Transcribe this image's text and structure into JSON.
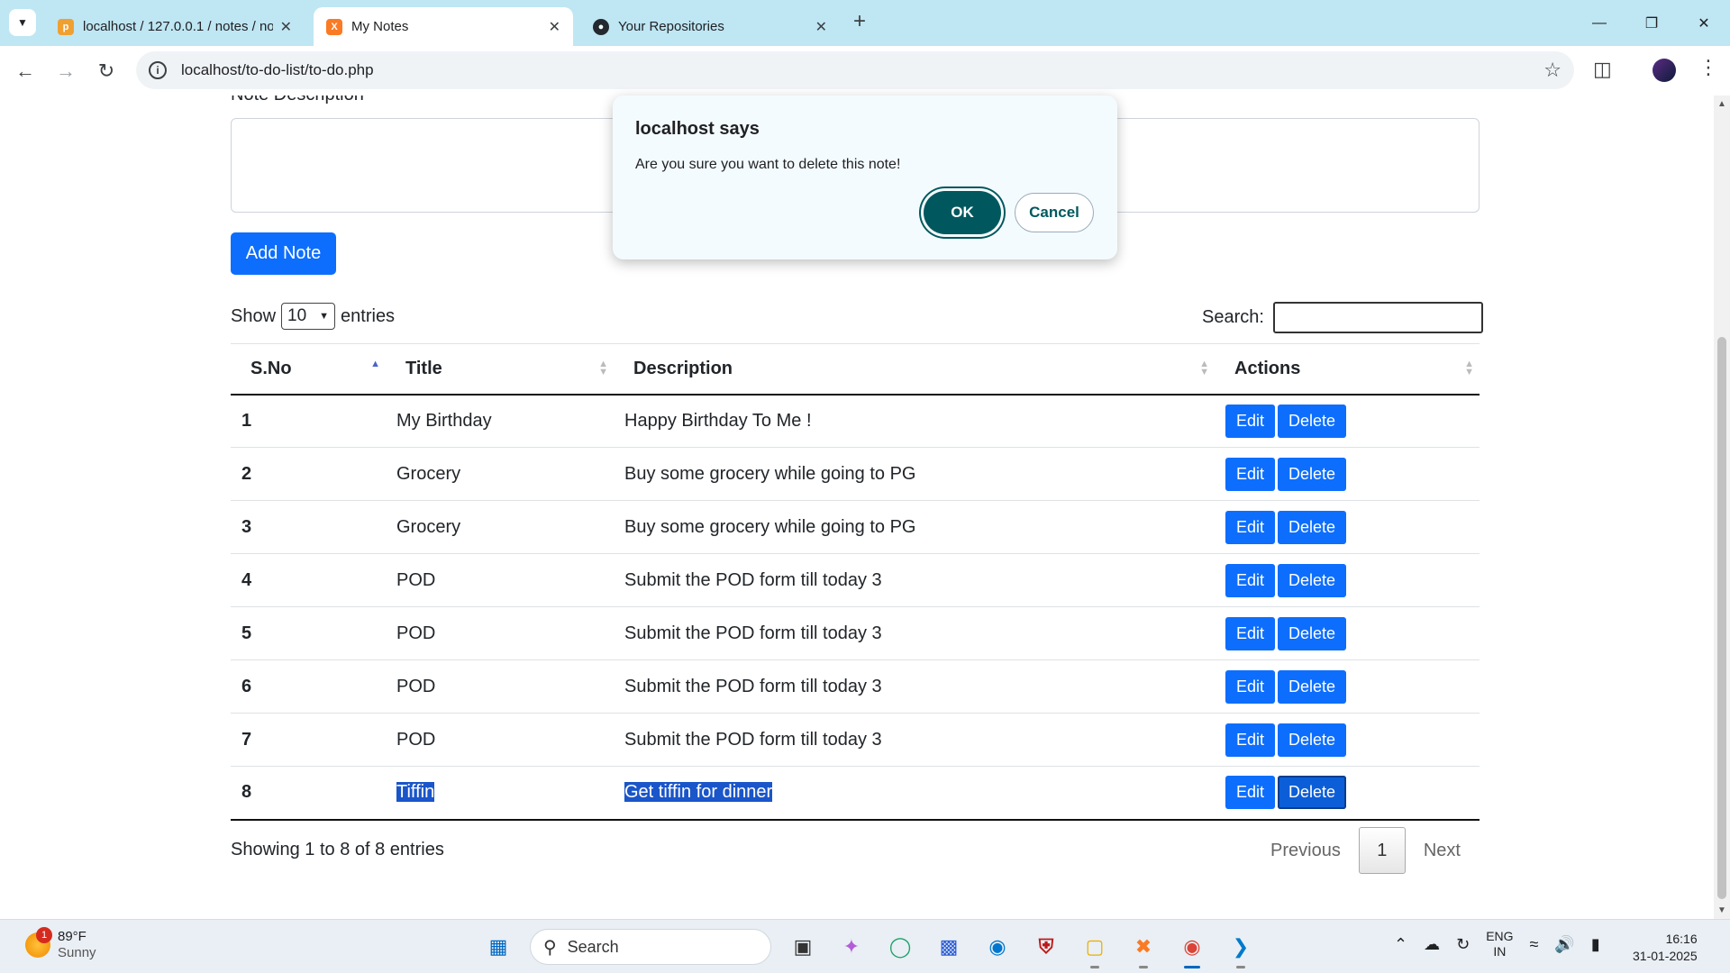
{
  "browser": {
    "tabs": [
      {
        "title": "localhost / 127.0.0.1 / notes / no",
        "favicon": "phpmyadmin-icon"
      },
      {
        "title": "My Notes",
        "favicon": "xampp-icon"
      },
      {
        "title": "Your Repositories",
        "favicon": "github-icon"
      }
    ],
    "new_tab": "+",
    "url": "localhost/to-do-list/to-do.php"
  },
  "form": {
    "desc_label": "Note Description",
    "add_button": "Add Note"
  },
  "table_controls": {
    "show_label": "Show",
    "entries_value": "10",
    "entries_label": "entries",
    "search_label": "Search:"
  },
  "table": {
    "headers": [
      "S.No",
      "Title",
      "Description",
      "Actions"
    ],
    "rows": [
      {
        "sno": "1",
        "title": "My Birthday",
        "desc": "Happy Birthday To Me !"
      },
      {
        "sno": "2",
        "title": "Grocery",
        "desc": "Buy some grocery while going to PG"
      },
      {
        "sno": "3",
        "title": "Grocery",
        "desc": "Buy some grocery while going to PG"
      },
      {
        "sno": "4",
        "title": "POD",
        "desc": "Submit the POD form till today 3"
      },
      {
        "sno": "5",
        "title": "POD",
        "desc": "Submit the POD form till today 3"
      },
      {
        "sno": "6",
        "title": "POD",
        "desc": "Submit the POD form till today 3"
      },
      {
        "sno": "7",
        "title": "POD",
        "desc": "Submit the POD form till today 3"
      },
      {
        "sno": "8",
        "title": "Tiffin",
        "desc": "Get tiffin for dinner"
      }
    ],
    "edit_label": "Edit",
    "delete_label": "Delete"
  },
  "footer": {
    "info": "Showing 1 to 8 of 8 entries",
    "previous": "Previous",
    "current_page": "1",
    "next": "Next"
  },
  "dialog": {
    "title": "localhost says",
    "message": "Are you sure you want to delete this note!",
    "ok": "OK",
    "cancel": "Cancel"
  },
  "taskbar": {
    "weather_badge": "1",
    "temperature": "89°F",
    "condition": "Sunny",
    "search_label": "Search",
    "lang_top": "ENG",
    "lang_bottom": "IN",
    "time": "16:16",
    "date": "31-01-2025"
  },
  "colors": {
    "primary_button": "#0d6efd",
    "dialog_ok": "#00585e",
    "tabstrip": "#bfe6f3",
    "selection": "#1a55c9"
  }
}
